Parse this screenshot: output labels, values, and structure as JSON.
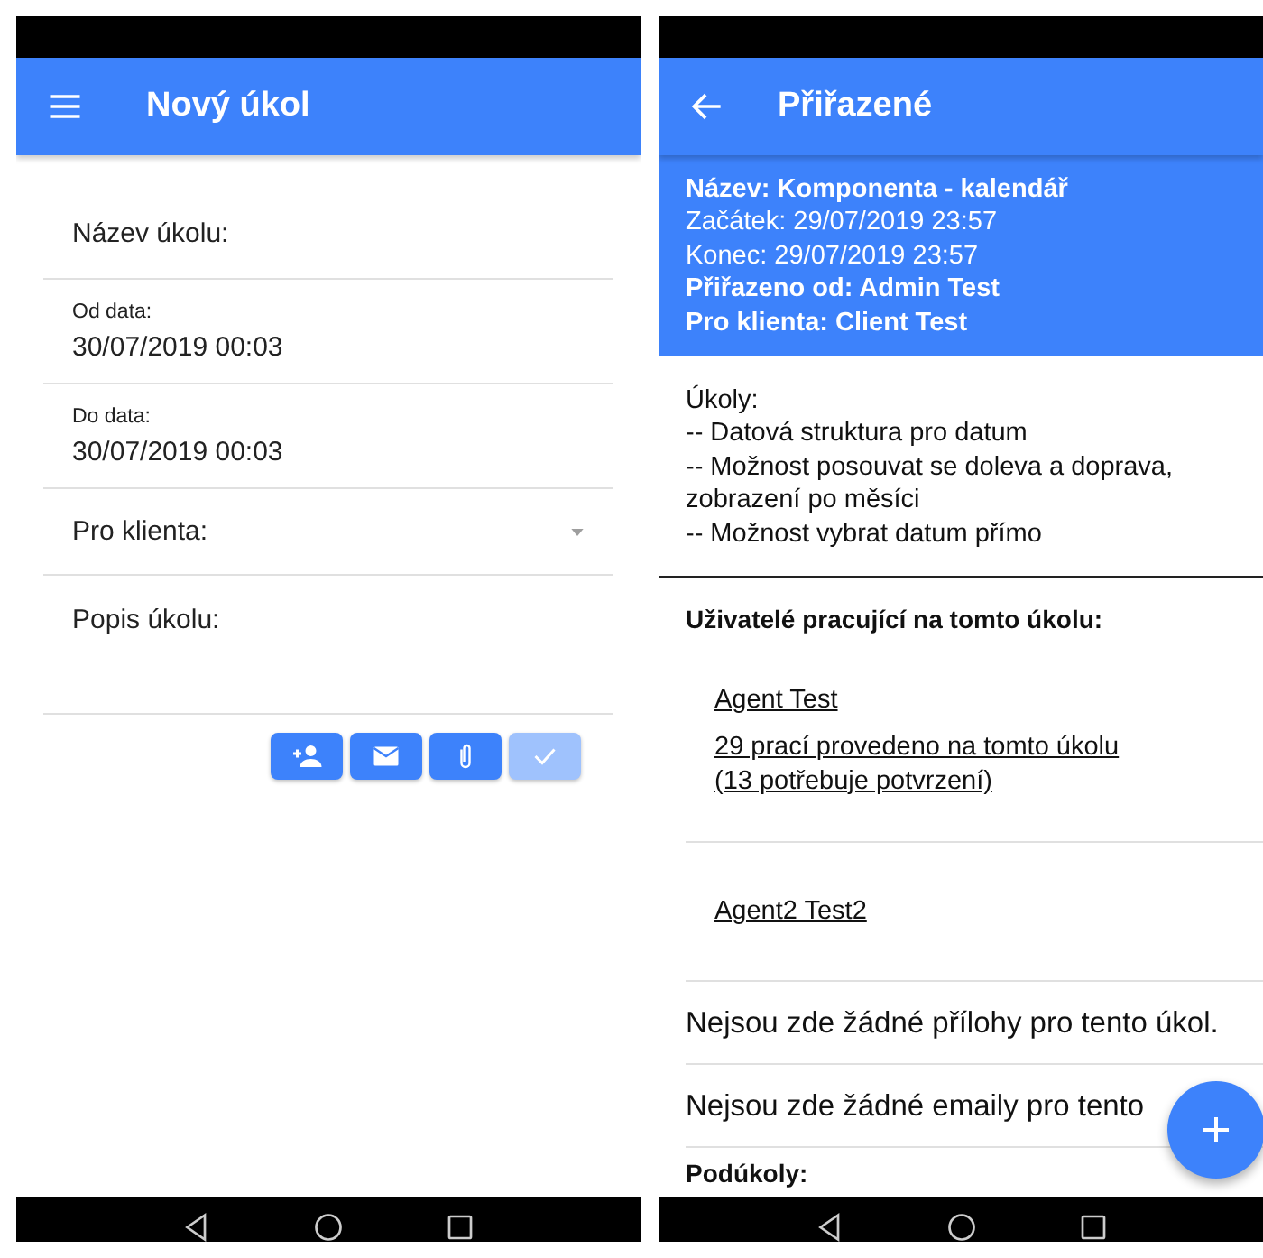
{
  "screens": [
    {
      "kind": "form",
      "appbar": {
        "kind": "menu",
        "title": "Nový úkol"
      },
      "fields": [
        {
          "kind": "text",
          "label": "Název úkolu:"
        },
        {
          "kind": "date",
          "label": "Od data:",
          "value": "30/07/2019 00:03"
        },
        {
          "kind": "date",
          "label": "Do data:",
          "value": "30/07/2019 00:03"
        },
        {
          "kind": "select",
          "label": "Pro klienta:"
        },
        {
          "kind": "textarea",
          "label": "Popis úkolu:"
        }
      ],
      "actions": [
        {
          "kind": "add_user",
          "disabled": false
        },
        {
          "kind": "email",
          "disabled": false
        },
        {
          "kind": "attach",
          "disabled": false
        },
        {
          "kind": "confirm",
          "disabled": true
        }
      ]
    },
    {
      "kind": "detail",
      "appbar": {
        "kind": "back",
        "title": "Přiřazené"
      },
      "details": [
        {
          "text": "Název: Komponenta - kalendář",
          "bold": true
        },
        {
          "text": "Začátek: 29/07/2019 23:57",
          "bold": false
        },
        {
          "text": "Konec: 29/07/2019 23:57",
          "bold": false
        },
        {
          "text": "Přiřazeno od: Admin Test",
          "bold": true
        },
        {
          "text": "Pro klienta: Client Test",
          "bold": true
        }
      ],
      "description": [
        "Úkoly:",
        "-- Datová struktura pro datum",
        "-- Možnost posouvat se doleva a doprava, zobrazení po měsíci",
        "-- Možnost vybrat datum přímo"
      ],
      "users_heading": "Uživatelé pracující na tomto úkolu:",
      "users": [
        {
          "name": "Agent Test",
          "work": "29 prací provedeno na tomto úkolu (13 potřebuje potvrzení)"
        },
        {
          "name": "Agent2 Test2"
        }
      ],
      "messages": [
        "Nejsou zde žádné přílohy pro tento úkol.",
        "Nejsou zde žádné emaily pro tento"
      ],
      "subtasks_heading": "Podúkoly:",
      "fab": {
        "kind": "add"
      }
    }
  ]
}
